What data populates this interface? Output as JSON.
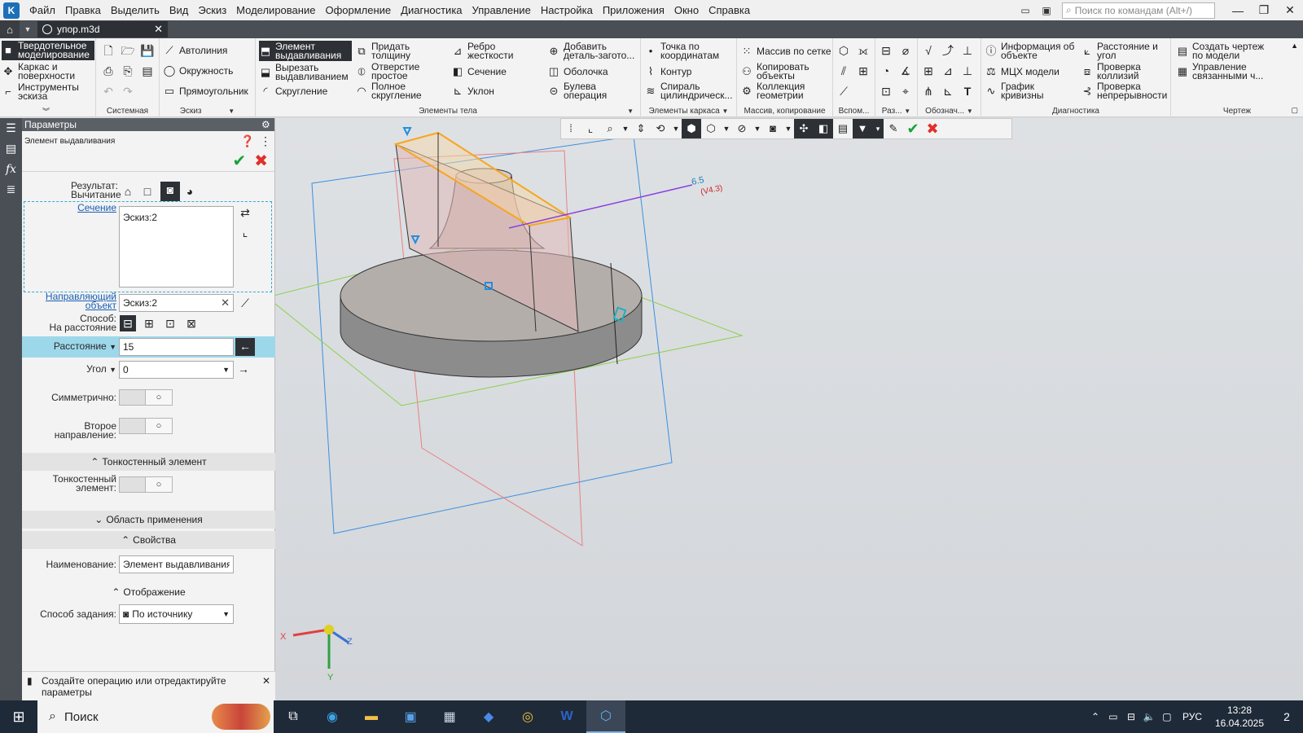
{
  "app": {
    "logo": "K",
    "menu": [
      "Файл",
      "Правка",
      "Выделить",
      "Вид",
      "Эскиз",
      "Моделирование",
      "Оформление",
      "Диагностика",
      "Управление",
      "Настройка",
      "Приложения",
      "Окно",
      "Справка"
    ],
    "search_placeholder": "Поиск по командам (Alt+/)"
  },
  "tabs": {
    "doc_name": "упор.m3d"
  },
  "ribbon": {
    "left": {
      "solid": "Твердотельное моделирование",
      "wire": "Каркас и поверхности",
      "sketch_tools": "Инструменты эскиза"
    },
    "groups": {
      "system": "Системная",
      "sketch": "Эскиз",
      "body": "Элементы тела",
      "frame": "Элементы каркаса",
      "array": "Массив, копирование",
      "aux": "Вспом...",
      "razm": "Раз...",
      "oboz": "Обознач...",
      "diag": "Диагностика",
      "drawing": "Чертеж"
    },
    "sketch": {
      "autoline": "Автолиния",
      "circle": "Окружность",
      "rect": "Прямоугольник"
    },
    "body": {
      "extrude": "Элемент выдавливания",
      "cut": "Вырезать выдавливанием",
      "fillet": "Скругление",
      "thickness": "Придать толщину",
      "hole": "Отверстие простое",
      "hollow_fillet": "Полное скругление",
      "rib": "Ребро жесткости",
      "section": "Сечение",
      "draft": "Уклон",
      "add_blank": "Добавить деталь-загото...",
      "shell": "Оболочка",
      "bool": "Булева операция"
    },
    "frame": {
      "point": "Точка по координатам",
      "contour": "Контур",
      "spiral": "Спираль цилиндрическ..."
    },
    "array": {
      "grid": "Массив по сетке",
      "copy": "Копировать объекты",
      "collection": "Коллекция геометрии"
    },
    "diag": {
      "info": "Информация об объекте",
      "mcx": "МЦХ модели",
      "curvature": "График кривизны",
      "distance": "Расстояние и угол",
      "collision": "Проверка коллизий",
      "continuity": "Проверка непрерывности"
    },
    "drawing": {
      "create": "Создать чертеж по модели",
      "manage": "Управление связанными ч..."
    }
  },
  "panel": {
    "title": "Параметры",
    "operation": "Элемент выдавливания",
    "result_label": "Результат:",
    "result_value": "Вычитание",
    "section_link": "Сечение",
    "section_value": "Эскиз:2",
    "guide_link": "Направляющий объект",
    "guide_value": "Эскиз:2",
    "method_label": "Способ:",
    "method_value": "На расстояние",
    "distance_label": "Расстояние",
    "distance_value": "15",
    "angle_label": "Угол",
    "angle_value": "0",
    "symmetric_label": "Симметрично:",
    "second_dir_label": "Второе направление:",
    "thin_section": "Тонкостенный элемент",
    "thin_label": "Тонкостенный элемент:",
    "scope_section": "Область применения",
    "props_section": "Свойства",
    "name_label": "Наименование:",
    "name_value": "Элемент выдавливания:",
    "display_section": "Отображение",
    "spec_label": "Способ задания:",
    "spec_value": "По источнику",
    "hint": "Создайте операцию или отредактируйте параметры"
  },
  "viewport": {
    "dimension_value": "6.5",
    "dimension_sub": "(V4.3)",
    "axis_x": "X",
    "axis_y": "Y",
    "axis_z": "Z"
  },
  "taskbar": {
    "search": "Поиск",
    "lang": "РУС",
    "time": "13:28",
    "date": "16.04.2025",
    "notifications": "2"
  },
  "colors": {
    "accent": "#2d3136",
    "highlight": "#9dd8ea",
    "ok": "#18a33a",
    "cancel": "#e0302a"
  }
}
